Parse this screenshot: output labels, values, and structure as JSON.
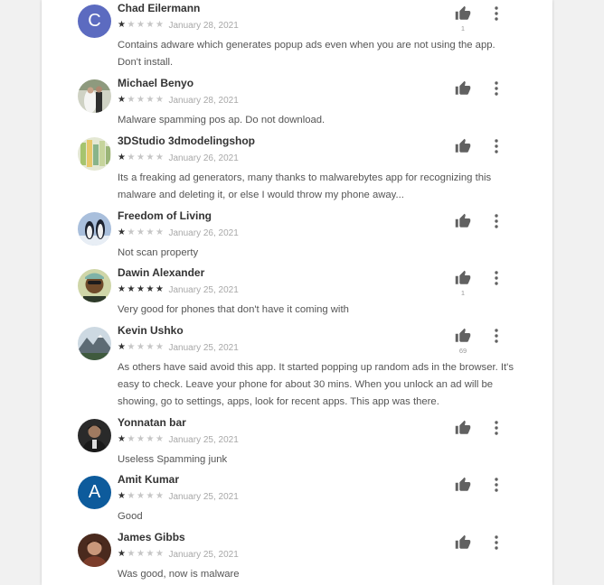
{
  "colors": {
    "card_bg": "#ffffff",
    "page_bg": "#f1f1f1",
    "name": "#333333",
    "star_filled": "#333333",
    "star_empty": "#c6c6c6",
    "date": "#a8a8a8",
    "body_text": "#555555",
    "icon": "#616161"
  },
  "reviews": [
    {
      "name": "Chad Eilermann",
      "avatar": {
        "type": "letter",
        "letter": "C",
        "color": "#5c6bc0"
      },
      "rating": 1,
      "date": "January 28, 2021",
      "text": "Contains adware which generates popup ads even when you are not using the app. Don't install.",
      "helpful_count": "1"
    },
    {
      "name": "Michael Benyo",
      "avatar": {
        "type": "photo",
        "icon": "wedding-photo-avatar",
        "color": "#9a9a86"
      },
      "rating": 1,
      "date": "January 28, 2021",
      "text": "Malware spamming pos ap. Do not download.",
      "helpful_count": ""
    },
    {
      "name": "3DStudio 3dmodelingshop",
      "avatar": {
        "type": "photo",
        "icon": "colorful-photo-avatar",
        "color": "#b4c38e"
      },
      "rating": 1,
      "date": "January 26, 2021",
      "text": "Its a freaking ad generators, many thanks to malwarebytes app for recognizing this malware and deleting it, or else I would throw my phone away...",
      "helpful_count": ""
    },
    {
      "name": "Freedom of Living",
      "avatar": {
        "type": "photo",
        "icon": "penguins-photo-avatar",
        "color": "#8fa6c4"
      },
      "rating": 1,
      "date": "January 26, 2021",
      "text": "Not scan property",
      "helpful_count": ""
    },
    {
      "name": "Dawin Alexander",
      "avatar": {
        "type": "photo",
        "icon": "person-photo-avatar",
        "color": "#6f5a3a"
      },
      "rating": 5,
      "date": "January 25, 2021",
      "text": "Very good for phones that don't have it coming with",
      "helpful_count": "1"
    },
    {
      "name": "Kevin Ushko",
      "avatar": {
        "type": "photo",
        "icon": "mountain-photo-avatar",
        "color": "#7a8f99"
      },
      "rating": 1,
      "date": "January 25, 2021",
      "text": "As others have said avoid this app. It started popping up random ads in the browser. It's easy to check. Leave your phone for about 30 mins. When you unlock an ad will be showing, go to settings, apps, look for recent apps. This app was there.",
      "helpful_count": "69"
    },
    {
      "name": "Yonnatan bar",
      "avatar": {
        "type": "photo",
        "icon": "person-photo-avatar",
        "color": "#3a3a3a"
      },
      "rating": 1,
      "date": "January 25, 2021",
      "text": "Useless Spamming junk",
      "helpful_count": ""
    },
    {
      "name": "Amit Kumar",
      "avatar": {
        "type": "letter",
        "letter": "A",
        "color": "#0d5b9c"
      },
      "rating": 1,
      "date": "January 25, 2021",
      "text": "Good",
      "helpful_count": ""
    },
    {
      "name": "James Gibbs",
      "avatar": {
        "type": "photo",
        "icon": "person-photo-avatar",
        "color": "#6b3a2a"
      },
      "rating": 1,
      "date": "January 25, 2021",
      "text": "Was good, now is malware",
      "helpful_count": ""
    }
  ]
}
